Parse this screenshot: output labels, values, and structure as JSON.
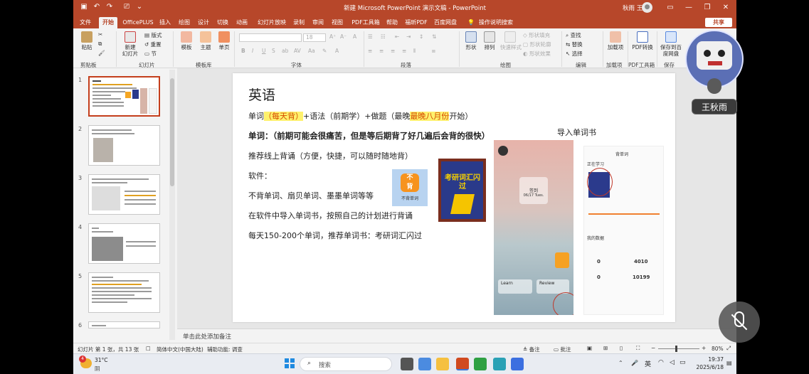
{
  "window": {
    "title": "新建 Microsoft PowerPoint 演示文稿 - PowerPoint",
    "user": "秋雨 王",
    "share": "共享"
  },
  "tabs": [
    "文件",
    "开始",
    "OfficePLUS",
    "插入",
    "绘图",
    "设计",
    "切换",
    "动画",
    "幻灯片放映",
    "录制",
    "审阅",
    "视图",
    "PDF工具箱",
    "帮助",
    "福昕PDF",
    "百度网盘",
    "操作说明搜索"
  ],
  "ribbon": {
    "groups": {
      "clipboard": "剪贴板",
      "slides": "幻灯片",
      "templates": "模板库",
      "font": "字体",
      "paragraph": "段落",
      "drawing": "绘图",
      "editing": "编辑",
      "addins": "加载项",
      "pdf": "PDF工具箱",
      "save": "保存"
    },
    "buttons": {
      "paste": "粘贴",
      "new_slide": "新建\n幻灯片",
      "layout": "版式",
      "reset": "重置",
      "section": "节",
      "template": "模板",
      "theme": "主题",
      "single": "单页",
      "shape": "形状",
      "arrange": "排列",
      "quick_style": "快速样式",
      "shape_fill": "形状填充",
      "shape_outline": "形状轮廓",
      "shape_effect": "形状效果",
      "find": "查找",
      "replace": "替换",
      "select": "选择",
      "addins": "加载项",
      "pdf_convert": "PDF转换",
      "save_baidu": "保存到百度网盘",
      "font_size": "18"
    }
  },
  "slides": [
    {
      "num": "1"
    },
    {
      "num": "2"
    },
    {
      "num": "3"
    },
    {
      "num": "4"
    },
    {
      "num": "5"
    },
    {
      "num": "6"
    }
  ],
  "slide": {
    "title": "英语",
    "line1": {
      "a": "单词",
      "b": "（每天背）",
      "c": "+语法（前期学）+做题（最晚",
      "d": "最晚八月份",
      "e": "开始）"
    },
    "line2": "单词：（前期可能会很痛苦，但是等后期背了好几遍后会背的很快）",
    "line3": "推荐线上背诵（方便，快捷，可以随时随地背）",
    "line4": "软件：",
    "line5": "不背单词、扇贝单词、墨墨单词等等",
    "line6": "在软件中导入单词书，按照自己的计划进行背诵",
    "line7": "每天150-200个单词，推荐单词书：考研词汇闪过",
    "import_label": "导入单词书",
    "book_title": "考研词汇闪过",
    "app_icon_label": "不背单词",
    "phone1": {
      "date_label": "签到",
      "date": "06/17 Tues.",
      "learn": "Learn",
      "review": "Review"
    },
    "phone2": {
      "header": "背单词",
      "studying": "正在学习",
      "my_data": "我的数据",
      "count1": "4010",
      "count2": "10199",
      "zero1": "0",
      "zero2": "0"
    }
  },
  "notes": "单击此处添加备注",
  "status": {
    "slide_info": "幻灯片 第 1 张，共 13 张",
    "language": "简体中文(中国大陆)",
    "accessibility": "辅助功能: 调查",
    "notes_btn": "备注",
    "comments_btn": "批注",
    "zoom": "80%"
  },
  "taskbar": {
    "weather_temp": "31°C",
    "weather_desc": "阴",
    "weather_badge": "4",
    "search": "搜索",
    "ime": "英",
    "time": "19:37",
    "date": "2025/6/18"
  },
  "meeting": {
    "name": "王秋雨"
  },
  "colors": {
    "accent": "#b7472a",
    "highlight": "#fef16c",
    "highlight_text": "#d64a00"
  }
}
